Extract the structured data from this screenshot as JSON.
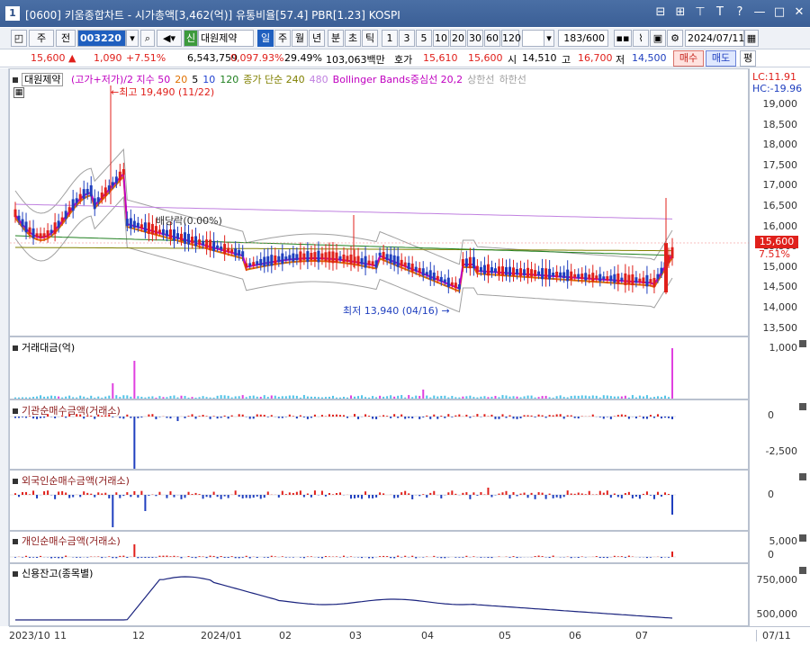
{
  "window": {
    "number": "1",
    "title": "[0600] 키움종합차트 - 시가총액[3,462(억)] 유통비율[57.4] PBR[1.23] KOSPI",
    "controls": [
      "⊟",
      "⊞",
      "⊤",
      "T",
      "?",
      "—",
      "□",
      "✕"
    ]
  },
  "toolbar": {
    "mode": "주",
    "prev": "전",
    "code": "003220",
    "name": "대원제약",
    "name_badge": "신",
    "periods": [
      "일",
      "주",
      "월",
      "년",
      "분",
      "초",
      "틱"
    ],
    "selected_period": "일",
    "intervals": [
      "1",
      "3",
      "5",
      "10",
      "20",
      "30",
      "60",
      "120"
    ],
    "count": "183/600",
    "date": "2024/07/11"
  },
  "quote": {
    "price": "15,600",
    "change": "1,090",
    "change_pct": "+7.51%",
    "volume": "6,543,759",
    "vol_ratio": "0,097.93%",
    "turnover": "29.49%",
    "amount": "103,063백만",
    "ask_label": "호가",
    "ask": "15,610",
    "bid": "15,600",
    "open_label": "시",
    "open": "14,510",
    "high_label": "고",
    "high": "16,700",
    "low_label": "저",
    "low": "14,500",
    "buy": "매수",
    "sell": "매도",
    "avg": "평"
  },
  "price_panel": {
    "stock_label": "대원제약",
    "legend": [
      {
        "text": "(고가+저가)/2 지수 50",
        "color": "#c000c0"
      },
      {
        "text": "20",
        "color": "#e07000"
      },
      {
        "text": "5",
        "color": "#000000"
      },
      {
        "text": "10",
        "color": "#2040d0"
      },
      {
        "text": "120",
        "color": "#208020"
      },
      {
        "text": "종가 단순 240",
        "color": "#808000"
      },
      {
        "text": "480",
        "color": "#c080e0"
      },
      {
        "text": "Bollinger Bands중심선 20,2",
        "color": "#c000c0"
      },
      {
        "text": "상한선",
        "color": "#a0a0a0"
      },
      {
        "text": "하한선",
        "color": "#a0a0a0"
      }
    ],
    "lc": "LC:11.91",
    "hc": "HC:-19.96",
    "y_ticks": [
      "19,000",
      "18,500",
      "18,000",
      "17,500",
      "17,000",
      "16,500",
      "16,000",
      "15,500",
      "15,000",
      "14,500",
      "14,000",
      "13,500"
    ],
    "current_tag": "15,600",
    "current_pct": "7.51%",
    "high_note": "최고 19,490 (11/22)",
    "low_note": "최저 13,940 (04/16)",
    "mid_note": "배당락(0.00%)"
  },
  "panels": {
    "trade_amount": {
      "label": "거래대금(억)",
      "ticks": [
        "1,000"
      ]
    },
    "institution": {
      "label": "기관순매수금액(거래소)",
      "ticks": [
        "0",
        "-2,500"
      ]
    },
    "foreign": {
      "label": "외국인순매수금액(거래소)",
      "ticks": [
        "0"
      ]
    },
    "individual": {
      "label": "개인순매수금액(거래소)",
      "ticks": [
        "5,000",
        "0"
      ]
    },
    "credit": {
      "label": "신용잔고(종목별)",
      "ticks": [
        "750,000",
        "500,000"
      ]
    }
  },
  "x_axis": {
    "labels": [
      "2023/10",
      "11",
      "12",
      "2024/01",
      "02",
      "03",
      "04",
      "05",
      "06",
      "07"
    ],
    "end": "07/11"
  },
  "colors": {
    "up": "#e0201b",
    "down": "#1f3fbf",
    "titlebar": "#3b5f96"
  }
}
